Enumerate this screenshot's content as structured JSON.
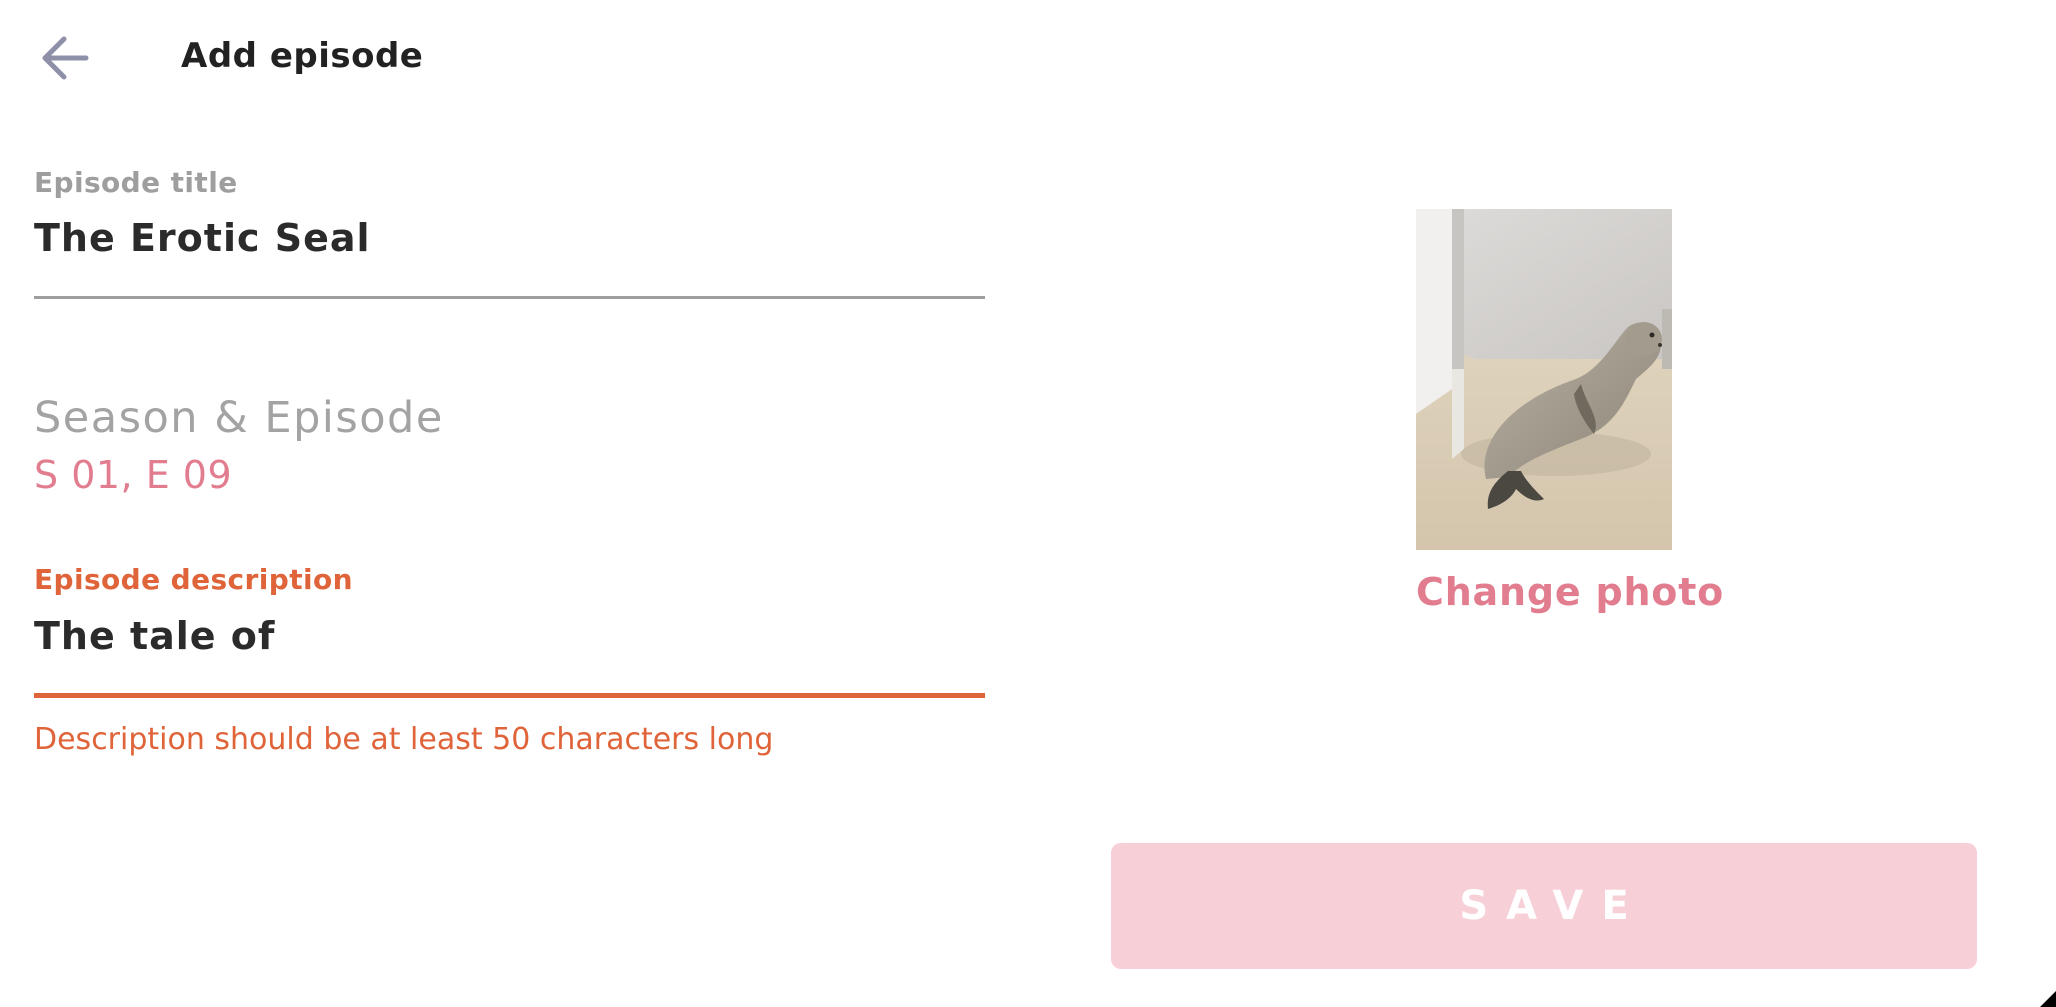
{
  "header": {
    "title": "Add episode",
    "back_icon": "arrow-left-icon"
  },
  "form": {
    "title_field": {
      "label": "Episode title",
      "value": "The Erotic Seal"
    },
    "season_episode": {
      "label": "Season & Episode",
      "value": "S 01, E 09"
    },
    "description_field": {
      "label": "Episode description",
      "value": "The tale of",
      "error": "Description should be at least 50 characters long"
    }
  },
  "photo": {
    "change_label": "Change photo"
  },
  "actions": {
    "save_label": "SAVE"
  },
  "colors": {
    "accent_pink": "#e27d8f",
    "error_orange": "#e0643a",
    "save_disabled_bg": "#f7cfd7",
    "label_gray": "#9e9e9e"
  }
}
